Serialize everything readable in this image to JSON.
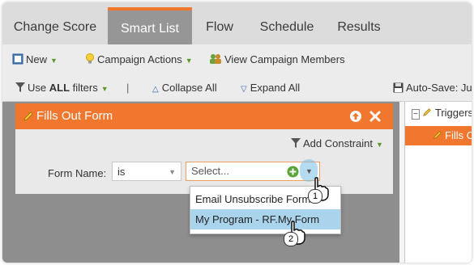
{
  "tabs": [
    {
      "label": "Change Score"
    },
    {
      "label": "Smart List"
    },
    {
      "label": "Flow"
    },
    {
      "label": "Schedule"
    },
    {
      "label": "Results"
    }
  ],
  "active_tab": "Smart List",
  "toolbar": {
    "new_label": "New",
    "campaign_actions_label": "Campaign Actions",
    "view_members_label": "View Campaign Members"
  },
  "filterbar": {
    "use_label": "Use",
    "all_label": "ALL",
    "filters_label": "filters",
    "separator": "|",
    "collapse_label": "Collapse All",
    "expand_label": "Expand All",
    "autosave_label": "Auto-Save: Jul"
  },
  "filter_card": {
    "title": "Fills Out Form",
    "add_constraint_label": "Add Constraint",
    "form_name_label": "Form Name:",
    "operator_value": "is",
    "value_placeholder": "Select..."
  },
  "dropdown": {
    "items": [
      {
        "label": "Email Unsubscribe Form"
      },
      {
        "label": "My Program - RF.My Form"
      }
    ]
  },
  "right_panel": {
    "triggers_label": "Triggers",
    "selected_item_label": "Fills O"
  },
  "callouts": {
    "step1": "1",
    "step2": "2"
  },
  "colors": {
    "accent": "#f0772d",
    "highlight": "#aad4ec",
    "canvas": "#8e8e8e"
  }
}
